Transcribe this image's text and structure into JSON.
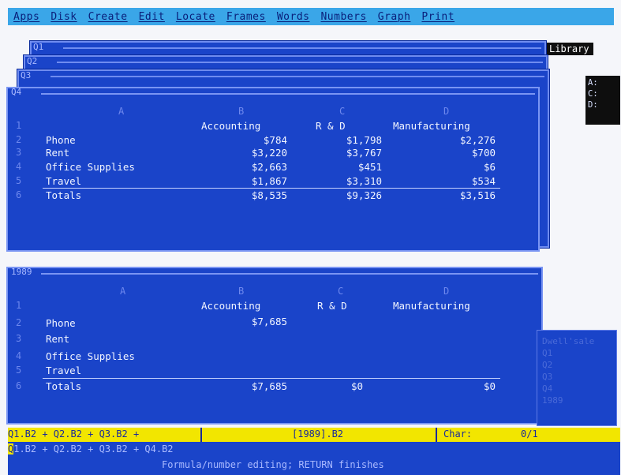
{
  "menu": [
    "Apps",
    "Disk",
    "Create",
    "Edit",
    "Locate",
    "Frames",
    "Words",
    "Numbers",
    "Graph",
    "Print"
  ],
  "library_label": "Library",
  "drives": [
    "A:",
    "C:",
    "D:"
  ],
  "stack_frames": [
    "Q1",
    "Q2",
    "Q3",
    "Q4"
  ],
  "top_sheet": {
    "name": "Q4",
    "col_letters": [
      "A",
      "B",
      "C",
      "D"
    ],
    "row_numbers": [
      "1",
      "2",
      "3",
      "4",
      "5",
      "6"
    ],
    "headers": [
      "Accounting",
      "R & D",
      "Manufacturing"
    ],
    "rows": [
      {
        "label": "Phone",
        "values": [
          "$784",
          "$1,798",
          "$2,276"
        ]
      },
      {
        "label": "Rent",
        "values": [
          "$3,220",
          "$3,767",
          "$700"
        ]
      },
      {
        "label": "Office Supplies",
        "values": [
          "$2,663",
          "$451",
          "$6"
        ]
      },
      {
        "label": "Travel",
        "values": [
          "$1,867",
          "$3,310",
          "$534"
        ]
      }
    ],
    "totals": {
      "label": "Totals",
      "values": [
        "$8,535",
        "$9,326",
        "$3,516"
      ]
    }
  },
  "bottom_sheet": {
    "name": "1989",
    "col_letters": [
      "A",
      "B",
      "C",
      "D"
    ],
    "row_numbers": [
      "1",
      "2",
      "3",
      "4",
      "5",
      "6"
    ],
    "headers": [
      "Accounting",
      "R & D",
      "Manufacturing"
    ],
    "rows": [
      {
        "label": "Phone",
        "values": [
          "$7,685",
          "",
          ""
        ]
      },
      {
        "label": "Rent",
        "values": [
          "",
          "",
          ""
        ]
      },
      {
        "label": "Office Supplies",
        "values": [
          "",
          "",
          ""
        ]
      },
      {
        "label": "Travel",
        "values": [
          "",
          "",
          ""
        ]
      }
    ],
    "totals": {
      "label": "Totals",
      "values": [
        "$7,685",
        "$0",
        "$0"
      ]
    }
  },
  "doclist": [
    "Dwell'sale",
    "Q1",
    "Q2",
    "Q3",
    "Q4",
    "1989"
  ],
  "formula_bar": {
    "formula": "Q1.B2 + Q2.B2 + Q3.B2 +",
    "cell_ref": "[1989].B2",
    "char_label": "Char:",
    "char_value": "0/1"
  },
  "edit_line": {
    "cursor_char": "Q",
    "formula_rest": "1.B2 + Q2.B2 + Q3.B2 + Q4.B2",
    "status": "Formula/number editing; RETURN finishes"
  },
  "colors": {
    "menu_bg": "#3aa6e8",
    "sheet_bg": "#1a44c9",
    "formula_bg": "#f2e600"
  }
}
